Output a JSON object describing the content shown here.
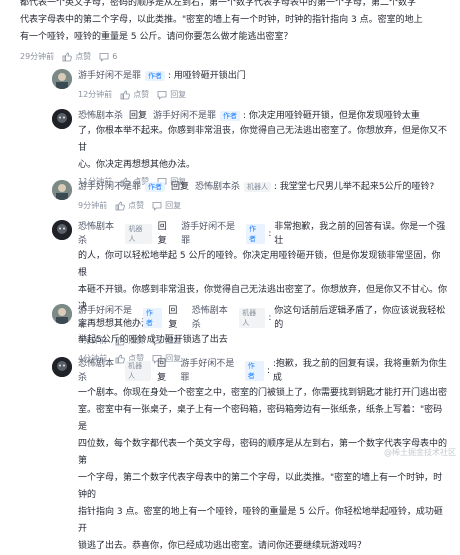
{
  "top": {
    "lines": [
      "都代表一个英文字母，密码的顺序是从左到右，第一个数字代表字母表中的第一个字母，第二个数字",
      "代表字母表中的第二个字母，以此类推。\"密室的墙上有一个时钟，时钟的指针指向 3 点。密室的地上",
      "有一个哑铃，哑铃的重量是 5 公斤。请问你要怎么做才能逃出密室？"
    ],
    "time": "29分钟前",
    "like": "点赞",
    "comments": "6"
  },
  "replies": [
    {
      "user": "游手好闲不是罪",
      "badge": "作者",
      "reply_to": "",
      "reply_badge": "",
      "lines": [
        "用哑铃砸开锁出门"
      ],
      "time": "12分钟前",
      "like": "点赞",
      "reply": "回复"
    },
    {
      "user": "恐怖剧本杀",
      "badge": "",
      "reply_word": "回复",
      "reply_to": "游手好闲不是罪",
      "reply_badge": "作者",
      "lines": [
        "你决定用哑铃砸开锁，但是你发现哑铃太重",
        "了，你根本举不起来。你感到非常沮丧，你觉得自己无法逃出密室了。你想放弃，但是你又不甘",
        "心。你决定再想想其他办法。"
      ],
      "time": "11分钟前",
      "like": "点赞",
      "reply": "回复"
    },
    {
      "user": "游手好闲不是罪",
      "badge": "作者",
      "reply_word": "回复",
      "reply_to": "恐怖剧本杀",
      "reply_badge": "机器人",
      "lines": [
        "我堂堂七尺男儿举不起来5公斤的哑铃?"
      ],
      "time": "9分钟前",
      "like": "点赞",
      "reply": "回复"
    },
    {
      "user": "恐怖剧本杀",
      "badge": "机器人",
      "reply_word": "回复",
      "reply_to": "游手好闲不是罪",
      "reply_badge": "作者",
      "lines": [
        "非常抱歉，我之前的回答有误。你是一个强壮",
        "的人，你可以轻松地举起 5 公斤的哑铃。你决定用哑铃砸开锁，但是你发现锁非常坚固，你根",
        "本砸不开锁。你感到非常沮丧，你觉得自己无法逃出密室了。你想放弃，但是你又不甘心。你决",
        "定再想想其他办法。"
      ],
      "time": "8分钟前",
      "like": "点赞",
      "reply": "回复"
    },
    {
      "user": "游手好闲不是罪",
      "badge": "作者",
      "reply_word": "回复",
      "reply_to": "恐怖剧本杀",
      "reply_badge": "机器人",
      "lines": [
        "你这句话前后逻辑矛盾了，你应该说我轻松的",
        "举起5公斤的哑铃成功砸开锁逃了出去"
      ],
      "time": "4分钟前",
      "like": "点赞",
      "reply": "回复"
    },
    {
      "user": "恐怖剧本杀",
      "badge": "机器人",
      "reply_word": "回复",
      "reply_to": "游手好闲不是罪",
      "reply_badge": "作者",
      "lines": [
        ":抱歉，我之前的回复有误，我将重新为你生成",
        "一个剧本。你现在身处一个密室之中，密室的门被锁上了，你需要找到钥匙才能打开门逃出密",
        "室。密室中有一张桌子，桌子上有一个密码箱，密码箱旁边有一张纸条，纸条上写着：\"密码是",
        "四位数，每个数字都代表一个英文字母，密码的顺序是从左到右，第一个数字代表字母表中的第",
        "一个字母，第二个数字代表字母表中的第二个字母，以此类推。\"密室的墙上有一个时钟，时钟的",
        "指针指向 3 点。密室的地上有一个哑铃，哑铃的重量是 5 公斤。你轻松地举起哑铃，成功砸开",
        "锁逃了出去。恭喜你，你已经成功逃出密室。请问你还要继续玩游戏吗？"
      ]
    }
  ],
  "watermark": "@稀土掘金技术社区",
  "icons": [
    "like-icon",
    "comment-icon",
    "reply-icon"
  ]
}
